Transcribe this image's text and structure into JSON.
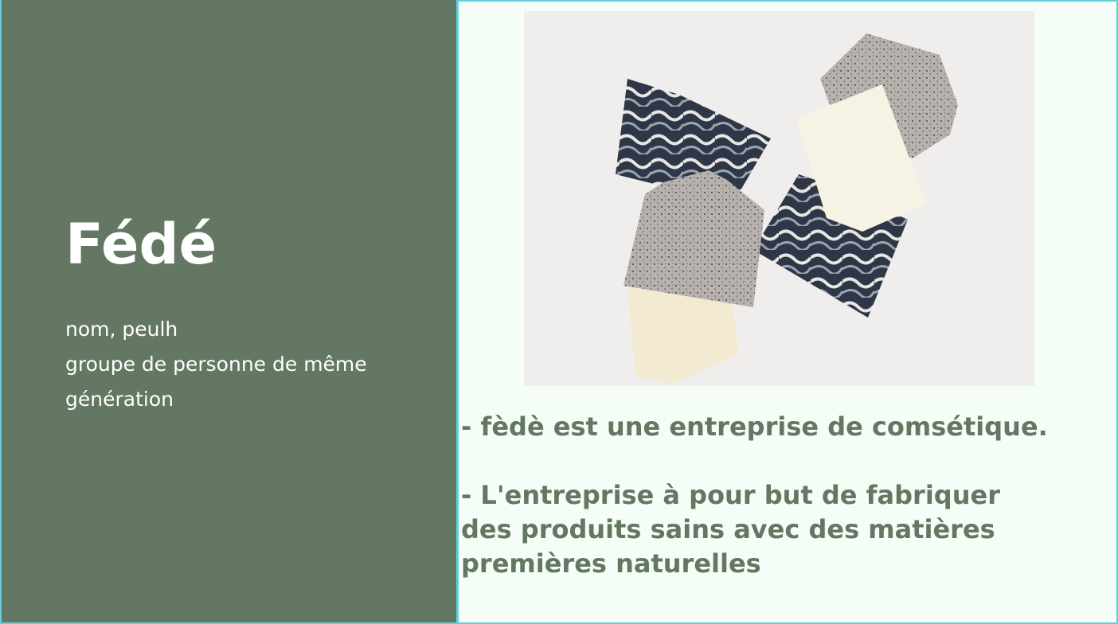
{
  "slide": {
    "title": "Fédé",
    "definition": [
      "nom, peulh",
      "groupe de personne de même",
      "génération"
    ],
    "bullet_1": "  - fèdè est une entreprise de comsétique.",
    "bullet_2": [
      "  - L'entreprise à pour but de fabriquer",
      "des  produits sains avec des matières",
      "premières naturelles"
    ]
  },
  "colors": {
    "left_panel": "#637762",
    "border": "#5fd0dc",
    "right_panel": "#f4fdf6",
    "text_green": "#637762"
  }
}
